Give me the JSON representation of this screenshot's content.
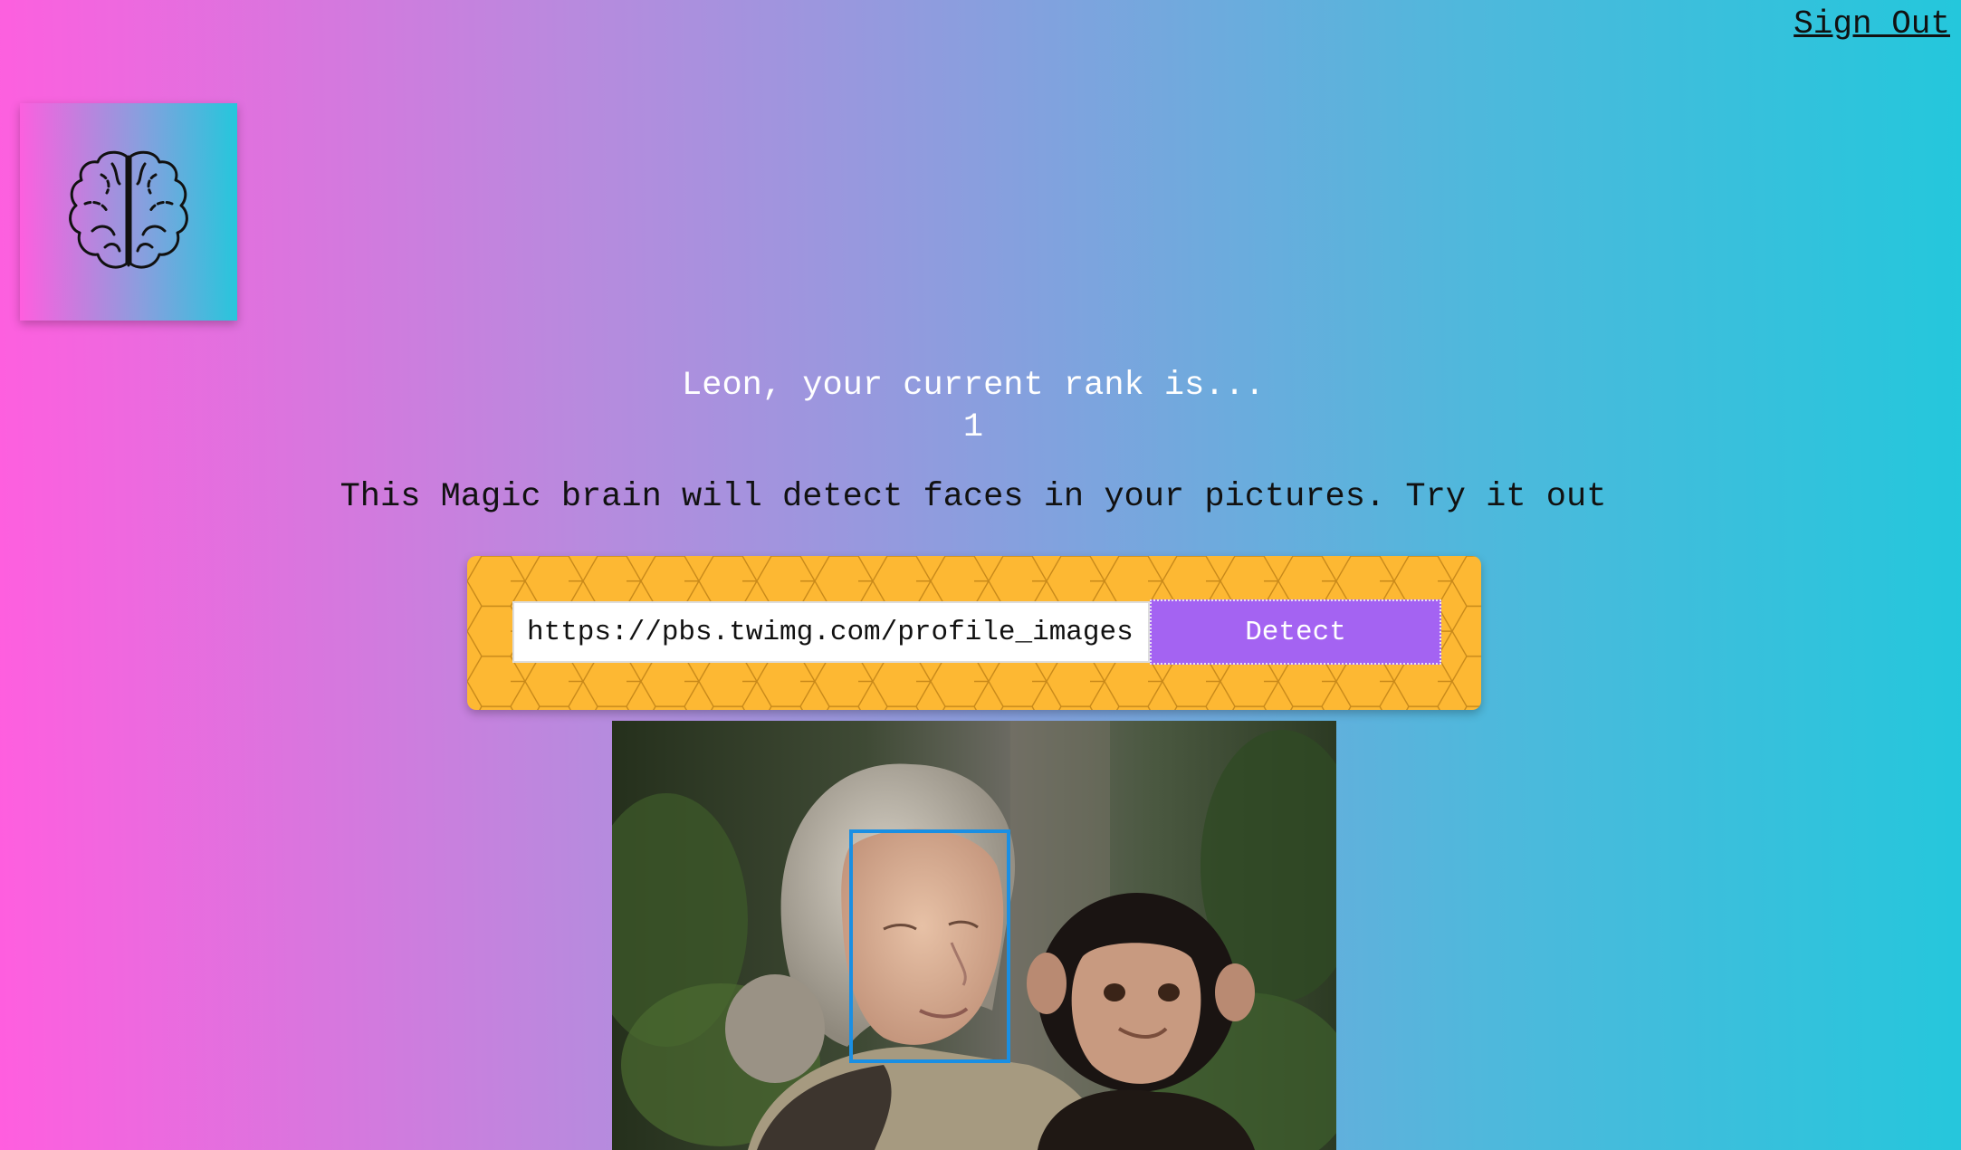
{
  "nav": {
    "sign_out": "Sign Out"
  },
  "logo": {
    "icon": "brain-icon"
  },
  "rank": {
    "message": "Leon, your current rank is...",
    "value": "1"
  },
  "intro": {
    "text": "This Magic brain will detect faces in your pictures. Try it out"
  },
  "form": {
    "url_value": "https://pbs.twimg.com/profile_images",
    "detect_label": "Detect"
  },
  "result": {
    "image_icon": "portrait-photo",
    "face_box_icon": "face-bounding-box"
  },
  "colors": {
    "gradient_start": "#ff5edf",
    "gradient_end": "#24c7dc",
    "panel": "#fdb833",
    "button": "#a463f2",
    "face_box": "#1a8fe3"
  }
}
